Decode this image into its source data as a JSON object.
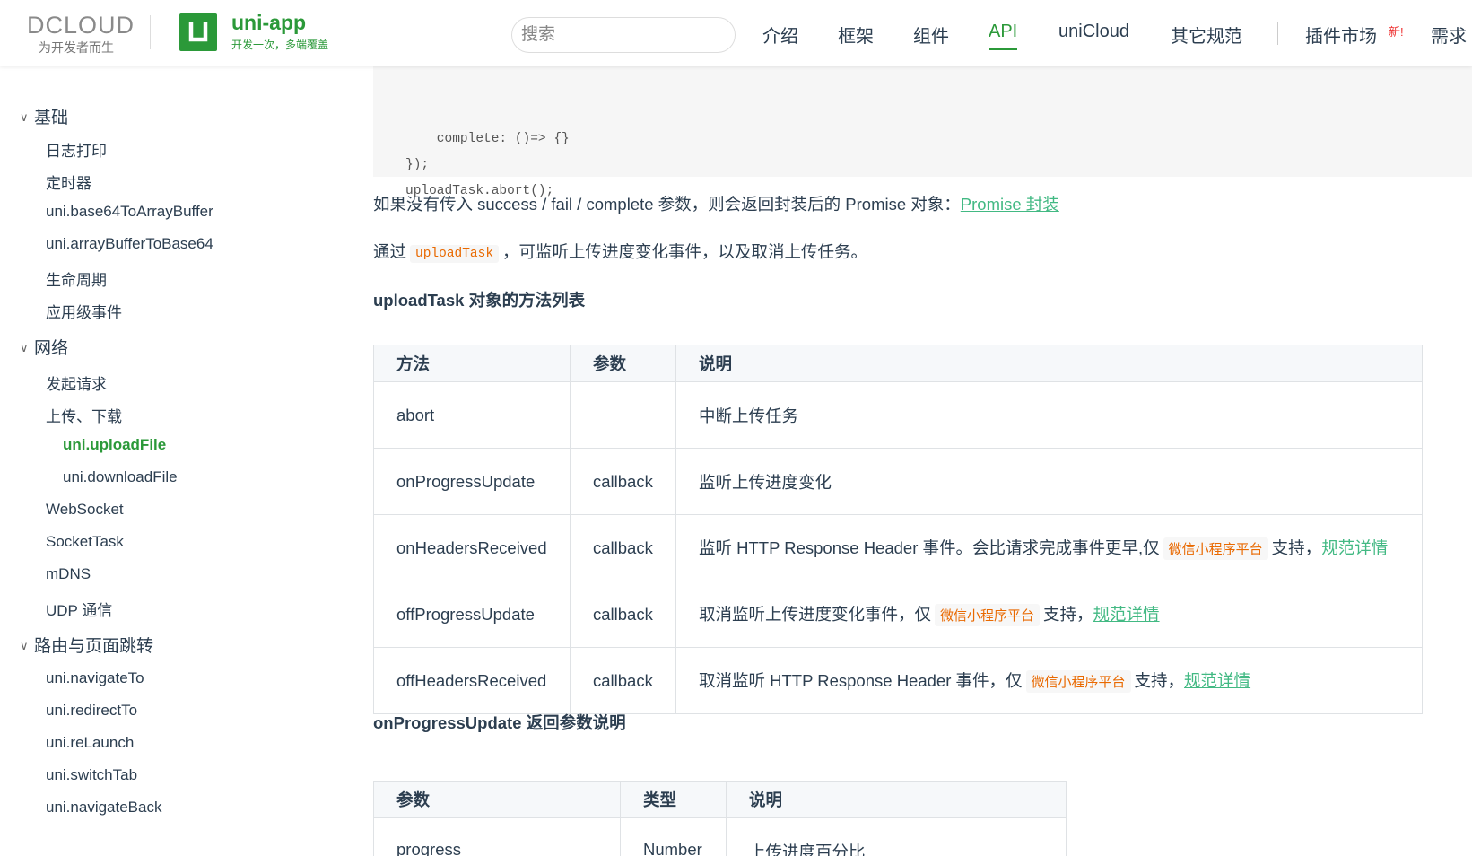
{
  "header": {
    "dcloud_word": "DCLOUD",
    "dcloud_slogan": "为开发者而生",
    "uni_title": "uni-app",
    "uni_slogan": "开发一次，多端覆盖",
    "search_placeholder": "搜索",
    "nav": [
      "介绍",
      "框架",
      "组件",
      "API",
      "uniCloud",
      "其它规范",
      "插件市场",
      "需求"
    ],
    "active_nav": "API",
    "new_badge": "新!"
  },
  "sidebar": {
    "groups": [
      {
        "label": "基础",
        "items": [
          "日志打印",
          "定时器",
          "uni.base64ToArrayBuffer",
          "uni.arrayBufferToBase64",
          "生命周期",
          "应用级事件"
        ]
      },
      {
        "label": "网络",
        "items": [
          "发起请求",
          "上传、下载",
          "uni.uploadFile",
          "uni.downloadFile",
          "WebSocket",
          "SocketTask",
          "mDNS",
          "UDP 通信"
        ]
      },
      {
        "label": "路由与页面跳转",
        "items": [
          "uni.navigateTo",
          "uni.redirectTo",
          "uni.reLaunch",
          "uni.switchTab",
          "uni.navigateBack"
        ]
      }
    ],
    "active_item": "uni.uploadFile"
  },
  "main": {
    "code_lines": [
      "    complete: ()=> {}",
      "});",
      "uploadTask.abort();"
    ],
    "promise_text": "如果没有传入 success / fail / complete 参数，则会返回封装后的 Promise 对象：",
    "promise_link": "Promise 封装",
    "upload_text_before": "通过",
    "upload_code": "uploadTask",
    "upload_text_after": "，可监听上传进度变化事件，以及取消上传任务。",
    "methods_heading": "uploadTask 对象的方法列表",
    "methods_table": {
      "headers": [
        "方法",
        "参数",
        "说明"
      ],
      "rows": [
        {
          "method": "abort",
          "param": "",
          "desc": "中断上传任务",
          "platform": "",
          "after": "",
          "link": ""
        },
        {
          "method": "onProgressUpdate",
          "param": "callback",
          "desc": "监听上传进度变化",
          "platform": "",
          "after": "",
          "link": ""
        },
        {
          "method": "onHeadersReceived",
          "param": "callback",
          "desc": "监听 HTTP Response Header 事件。会比请求完成事件更早,仅",
          "platform": "微信小程序平台",
          "after": "支持，",
          "link": "规范详情"
        },
        {
          "method": "offProgressUpdate",
          "param": "callback",
          "desc": "取消监听上传进度变化事件，仅",
          "platform": "微信小程序平台",
          "after": "支持，",
          "link": "规范详情"
        },
        {
          "method": "offHeadersReceived",
          "param": "callback",
          "desc": "取消监听 HTTP Response Header 事件，仅",
          "platform": "微信小程序平台",
          "after": "支持，",
          "link": "规范详情"
        }
      ]
    },
    "progress_heading": "onProgressUpdate 返回参数说明",
    "params_table": {
      "headers": [
        "参数",
        "类型",
        "说明"
      ],
      "rows": [
        {
          "param": "progress",
          "type": "Number",
          "desc": "上传进度百分比"
        }
      ]
    }
  },
  "colors": {
    "brand": "#2b9939",
    "link": "#42b983",
    "code": "#e96900"
  }
}
